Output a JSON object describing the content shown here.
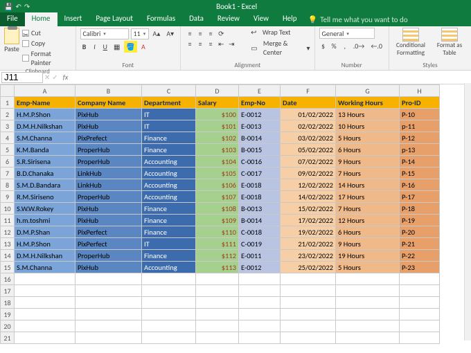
{
  "app": {
    "title": "Book1 - Excel"
  },
  "qat": {
    "save": "💾",
    "undo": "↶",
    "redo": "↷"
  },
  "tabs": {
    "file": "File",
    "home": "Home",
    "insert": "Insert",
    "pageLayout": "Page Layout",
    "formulas": "Formulas",
    "data": "Data",
    "review": "Review",
    "view": "View",
    "help": "Help",
    "tellme": "Tell me what you want to do"
  },
  "ribbon": {
    "clipboard": {
      "label": "Clipboard",
      "paste": "Paste",
      "cut": "Cut",
      "copy": "Copy",
      "painter": "Format Painter"
    },
    "font": {
      "label": "Font",
      "name": "Calibri",
      "size": "11",
      "bold": "B",
      "italic": "I",
      "underline": "U"
    },
    "alignment": {
      "label": "Alignment",
      "wrap": "Wrap Text",
      "merge": "Merge & Center"
    },
    "number": {
      "label": "Number",
      "format": "General"
    },
    "styles": {
      "label": "Styles",
      "cond": "Conditional Formatting",
      "formatas": "Format as Table"
    }
  },
  "namebox": {
    "ref": "J11",
    "fx": "fx"
  },
  "columns": [
    "A",
    "B",
    "C",
    "D",
    "E",
    "F",
    "G",
    "H"
  ],
  "header": {
    "A": "Emp-Name",
    "B": "Company Name",
    "C": "Department",
    "D": "Salary",
    "E": "Emp-No",
    "F": "Date",
    "G": "Working Hours",
    "H": "Pro-ID"
  },
  "rows": [
    {
      "r": 2,
      "A": "H.M.P.Shon",
      "B": "PixHub",
      "C": "IT",
      "D": "$100",
      "E": "E-0012",
      "F": "01/02/2022",
      "G": "13 Hours",
      "H": "P-10"
    },
    {
      "r": 3,
      "A": "D.M.H.Nilkshan",
      "B": "PixHub",
      "C": "IT",
      "D": "$101",
      "E": "E-0013",
      "F": "02/02/2022",
      "G": "10 Hours",
      "H": "p-11"
    },
    {
      "r": 4,
      "A": "S.M.Channa",
      "B": "PixPrefect",
      "C": "Finance",
      "D": "$102",
      "E": "B-0014",
      "F": "03/02/2022",
      "G": "5 Hours",
      "H": "P-12"
    },
    {
      "r": 5,
      "A": "K.M.Banda",
      "B": "ProperHub",
      "C": "Finance",
      "D": "$103",
      "E": "B-0015",
      "F": "05/02/2022",
      "G": "6 Hours",
      "H": "p-13"
    },
    {
      "r": 6,
      "A": "S.R.Sirisena",
      "B": "ProperHub",
      "C": "Accounting",
      "D": "$104",
      "E": "C-0016",
      "F": "07/02/2022",
      "G": "9 Hours",
      "H": "P-14"
    },
    {
      "r": 7,
      "A": "B.D.Chanaka",
      "B": "LinkHub",
      "C": "Accounting",
      "D": "$105",
      "E": "C-0017",
      "F": "09/02/2022",
      "G": "7 Hours",
      "H": "P-15"
    },
    {
      "r": 8,
      "A": "S.M.D.Bandara",
      "B": "LinkHub",
      "C": "Accounting",
      "D": "$106",
      "E": "E-0018",
      "F": "12/02/2022",
      "G": "14 Hours",
      "H": "P-16"
    },
    {
      "r": 9,
      "A": "R.M.Siriseno",
      "B": "ProperHub",
      "C": "Accounting",
      "D": "$107",
      "E": "E-0018",
      "F": "14/02/2022",
      "G": "17 Hours",
      "H": "P-17"
    },
    {
      "r": 10,
      "A": "S.W.W.Rokey",
      "B": "PixHub",
      "C": "Finance",
      "D": "$108",
      "E": "B-0013",
      "F": "15/02/2022",
      "G": "7 Hours",
      "H": "P-18"
    },
    {
      "r": 11,
      "A": "h.m.toshmi",
      "B": "PixHub",
      "C": "Finance",
      "D": "$109",
      "E": "B-0014",
      "F": "17/02/2022",
      "G": "12  Hours",
      "H": "P-19"
    },
    {
      "r": 12,
      "A": "D.M.P.Shan",
      "B": "PixPerfect",
      "C": "Finance",
      "D": "$110",
      "E": "C-0018",
      "F": "19/02/2022",
      "G": "6  Hours",
      "H": "P-20"
    },
    {
      "r": 13,
      "A": "H.M.P.Shon",
      "B": "PixPerfect",
      "C": "IT",
      "D": "$111",
      "E": "C-0019",
      "F": "21/02/2022",
      "G": "9 Hours",
      "H": "P-21"
    },
    {
      "r": 14,
      "A": "D.M.H.Nilkshan",
      "B": "ProperHub",
      "C": "Finance",
      "D": "$112",
      "E": "E-0011",
      "F": "23/02/2022",
      "G": "19 Hours",
      "H": "P-22"
    },
    {
      "r": 15,
      "A": "S.M.Channa",
      "B": "PixHub",
      "C": "Accounting",
      "D": "$113",
      "E": "E-0012",
      "F": "25/02/2022",
      "G": "5 Hours",
      "H": "P-23"
    }
  ],
  "blankRows": [
    16,
    17,
    18,
    19,
    20,
    21
  ]
}
